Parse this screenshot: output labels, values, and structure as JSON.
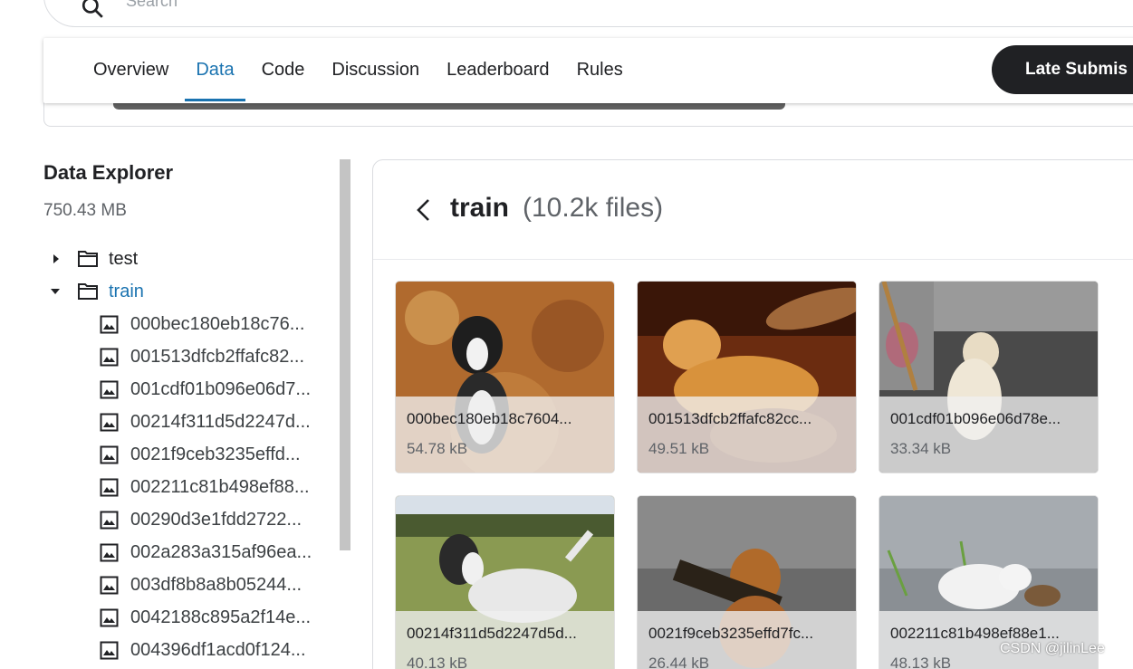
{
  "search": {
    "placeholder": "Search"
  },
  "tabs": [
    {
      "label": "Overview"
    },
    {
      "label": "Data",
      "active": true
    },
    {
      "label": "Code"
    },
    {
      "label": "Discussion"
    },
    {
      "label": "Leaderboard"
    },
    {
      "label": "Rules"
    }
  ],
  "late_submission_label": "Late Submis",
  "explorer": {
    "title": "Data Explorer",
    "size": "750.43 MB",
    "folders": [
      {
        "name": "test",
        "expanded": false
      },
      {
        "name": "train",
        "expanded": true
      }
    ],
    "files": [
      "000bec180eb18c76...",
      "001513dfcb2ffafc82...",
      "001cdf01b096e06d7...",
      "00214f311d5d2247d...",
      "0021f9ceb3235effd...",
      "002211c81b498ef88...",
      "00290d3e1fdd2722...",
      "002a283a315af96ea...",
      "003df8b8a8b05244...",
      "0042188c895a2f14e...",
      "004396df1acd0f124..."
    ]
  },
  "panel": {
    "title": "train",
    "count": "(10.2k files)"
  },
  "cards": [
    {
      "name": "000bec180eb18c7604...",
      "size": "54.78 kB"
    },
    {
      "name": "001513dfcb2ffafc82cc...",
      "size": "49.51 kB"
    },
    {
      "name": "001cdf01b096e06d78e...",
      "size": "33.34 kB"
    },
    {
      "name": "00214f311d5d2247d5d...",
      "size": "40.13 kB"
    },
    {
      "name": "0021f9ceb3235effd7fc...",
      "size": "26.44 kB"
    },
    {
      "name": "002211c81b498ef88e1...",
      "size": "48.13 kB"
    }
  ],
  "watermark": "CSDN @jilinLee",
  "colors": {
    "accent": "#1a73b0",
    "button_dark": "#202124"
  }
}
